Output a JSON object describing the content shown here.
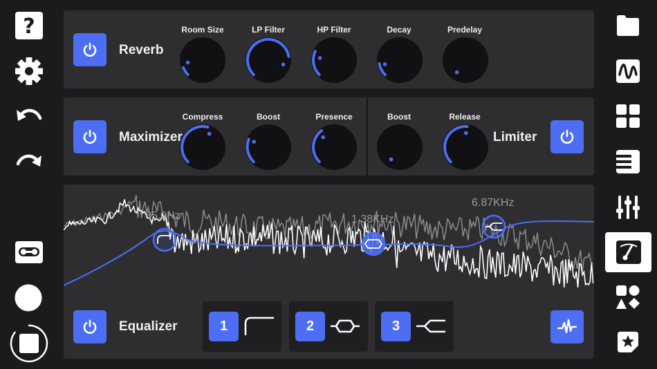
{
  "reverb": {
    "title": "Reverb",
    "knobs": [
      {
        "label": "Room Size"
      },
      {
        "label": "LP Filter"
      },
      {
        "label": "HP Filter"
      },
      {
        "label": "Decay"
      },
      {
        "label": "Predelay"
      }
    ]
  },
  "maximizer": {
    "title": "Maximizer",
    "knobs": [
      {
        "label": "Compress"
      },
      {
        "label": "Boost"
      },
      {
        "label": "Presence"
      }
    ]
  },
  "limiter": {
    "title": "Limiter",
    "knobs": [
      {
        "label": "Boost"
      },
      {
        "label": "Release"
      }
    ]
  },
  "equalizer": {
    "title": "Equalizer",
    "nodes": [
      {
        "label": "85.0Hz"
      },
      {
        "label": "1.38KHz"
      },
      {
        "label": "6.87KHz"
      }
    ],
    "bands": [
      {
        "number": "1",
        "shape": "low-shelf-icon"
      },
      {
        "number": "2",
        "shape": "bell-icon"
      },
      {
        "number": "3",
        "shape": "high-shelf-icon"
      }
    ]
  },
  "colors": {
    "accent": "#4d6ef2",
    "panel": "#2e2e31",
    "background": "#1b1b1d"
  }
}
